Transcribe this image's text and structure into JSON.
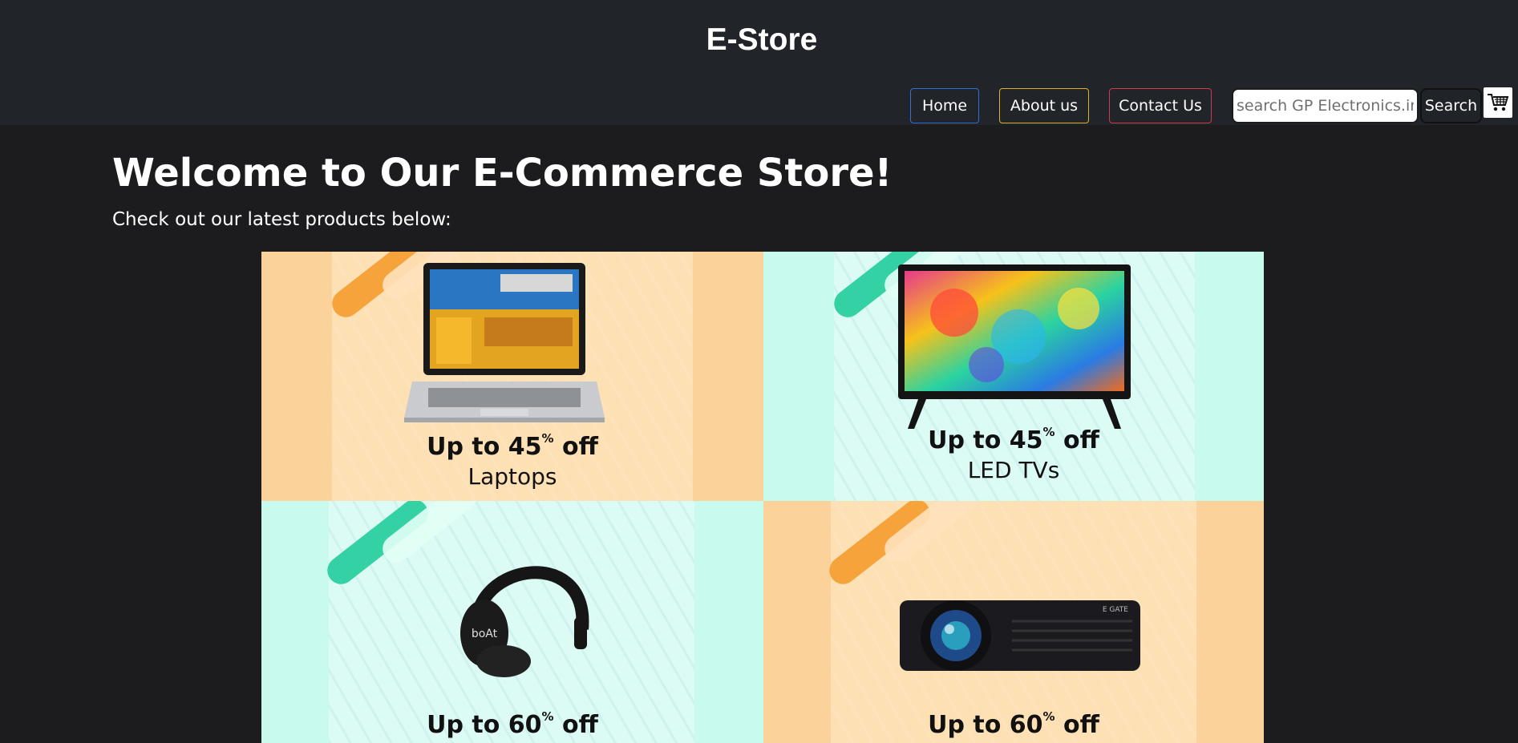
{
  "header": {
    "brand": "E-Store",
    "nav": {
      "home": "Home",
      "about": "About us",
      "contact": "Contact Us"
    },
    "search": {
      "placeholder": "search GP Electronics.in",
      "value": "",
      "button": "Search"
    },
    "cart_icon": "cart-icon"
  },
  "main": {
    "title": "Welcome to Our E-Commerce Store!",
    "subtitle": "Check out our latest products below:"
  },
  "banner": {
    "tiles": [
      {
        "offer_prefix": "Up to 45",
        "offer_suffix": "off",
        "category": "Laptops",
        "icon": "laptop-image",
        "bg": "#fbd299"
      },
      {
        "offer_prefix": "Up to 45",
        "offer_suffix": "off",
        "category": "LED TVs",
        "icon": "led-tv-image",
        "bg": "#c8fbee"
      },
      {
        "offer_prefix": "Up to 60",
        "offer_suffix": "off",
        "category": "",
        "icon": "headphones-image",
        "bg": "#c8fbee",
        "brand_mark": "boAt"
      },
      {
        "offer_prefix": "Up to 60",
        "offer_suffix": "off",
        "category": "",
        "icon": "projector-image",
        "bg": "#fbd299",
        "brand_mark": "E GATE"
      }
    ],
    "percent_sign": "%"
  },
  "colors": {
    "header_bg": "#212429",
    "page_bg": "#1c1b1d",
    "home_border": "#2d6fd6",
    "about_border": "#e0b126",
    "contact_border": "#d13a48"
  }
}
